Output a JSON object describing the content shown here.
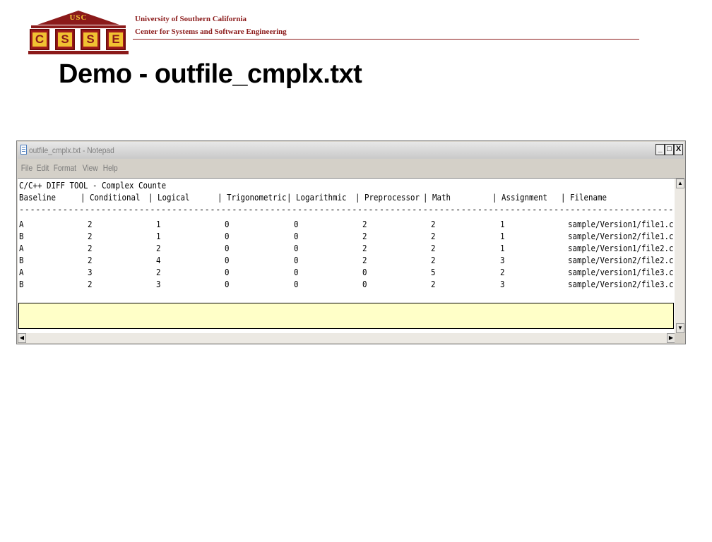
{
  "header": {
    "logo_top": "USC",
    "logo_letters": [
      "C",
      "S",
      "S",
      "E"
    ],
    "university": "University of Southern California",
    "center": "Center for Systems and Software Engineering"
  },
  "slide_title": "Demo - outfile_cmplx.txt",
  "window": {
    "title": "outfile_cmplx.txt - Notepad",
    "buttons": {
      "minimize": "_",
      "maximize": "□",
      "close": "X"
    },
    "menu": [
      "File",
      "Edit",
      "Format",
      "View",
      "Help"
    ],
    "heading": "C/C++ DIFF TOOL - Complex Counte",
    "columns": [
      "Baseline",
      "| Conditional",
      "| Logical",
      "| Trigonometric",
      "| Logarithmic",
      "| Preprocessor",
      "| Math",
      "| Assignment",
      "| Filename"
    ],
    "dashes": "------------------------------------------------------------------------------------------------------------------------------------------------------",
    "rows": [
      {
        "baseline": "A",
        "conditional": "2",
        "logical": "1",
        "trig": "0",
        "log": "0",
        "pre": "2",
        "math": "2",
        "assign": "1",
        "file": "sample/Version1/file1.c",
        "highlight": false
      },
      {
        "baseline": "B",
        "conditional": "2",
        "logical": "1",
        "trig": "0",
        "log": "0",
        "pre": "2",
        "math": "2",
        "assign": "1",
        "file": "sample/Version2/file1.c",
        "highlight": false
      },
      {
        "baseline": "A",
        "conditional": "2",
        "logical": "2",
        "trig": "0",
        "log": "0",
        "pre": "2",
        "math": "2",
        "assign": "1",
        "file": "sample/Version1/file2.c",
        "highlight": false
      },
      {
        "baseline": "B",
        "conditional": "2",
        "logical": "4",
        "trig": "0",
        "log": "0",
        "pre": "2",
        "math": "2",
        "assign": "3",
        "file": "sample/Version2/file2.c",
        "highlight": false
      },
      {
        "baseline": "A",
        "conditional": "3",
        "logical": "2",
        "trig": "0",
        "log": "0",
        "pre": "0",
        "math": "5",
        "assign": "2",
        "file": "sample/version1/file3.c",
        "highlight": true
      },
      {
        "baseline": "B",
        "conditional": "2",
        "logical": "3",
        "trig": "0",
        "log": "0",
        "pre": "0",
        "math": "2",
        "assign": "3",
        "file": "sample/Version2/file3.c",
        "highlight": true
      }
    ]
  }
}
